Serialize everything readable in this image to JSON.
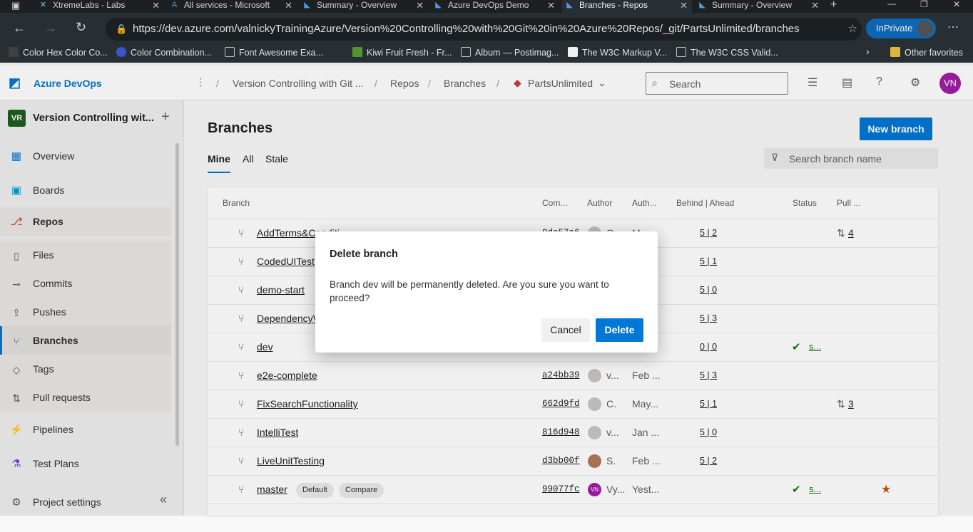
{
  "browser": {
    "tabs": [
      {
        "label": "XtremeLabs - Labs",
        "icon": "xtremelabs-icon"
      },
      {
        "label": "All services - Microsoft",
        "icon": "azure-icon"
      },
      {
        "label": "Summary - Overview",
        "icon": "azure-devops-icon"
      },
      {
        "label": "Azure DevOps Demo",
        "icon": "azure-devops-icon"
      },
      {
        "label": "Branches - Repos",
        "icon": "azure-devops-icon",
        "active": true
      },
      {
        "label": "Summary - Overview",
        "icon": "azure-devops-icon"
      }
    ],
    "url": "https://dev.azure.com/valnickyTrainingAzure/Version%20Controlling%20with%20Git%20in%20Azure%20Repos/_git/PartsUnlimited/branches",
    "inprivate_label": "InPrivate",
    "favorites": [
      "Color Hex Color Co...",
      "Color Combination...",
      "Font Awesome Exa...",
      "Kiwi Fruit Fresh - Fr...",
      "Album — Postimag...",
      "The W3C Markup V...",
      "The W3C CSS Valid..."
    ],
    "other_favorites": "Other favorites"
  },
  "header": {
    "brand": "Azure DevOps",
    "breadcrumb": [
      "Version Controlling with Git ...",
      "Repos",
      "Branches",
      "PartsUnlimited"
    ],
    "search_placeholder": "Search",
    "user_initials": "VN"
  },
  "project": {
    "badge": "VR",
    "name": "Version Controlling wit..."
  },
  "nav": {
    "items": [
      {
        "label": "Overview",
        "icon": "overview-icon"
      },
      {
        "label": "Boards",
        "icon": "boards-icon"
      },
      {
        "label": "Repos",
        "icon": "repos-icon"
      },
      {
        "label": "Files",
        "icon": "files-icon"
      },
      {
        "label": "Commits",
        "icon": "commits-icon"
      },
      {
        "label": "Pushes",
        "icon": "pushes-icon"
      },
      {
        "label": "Branches",
        "icon": "branches-icon"
      },
      {
        "label": "Tags",
        "icon": "tags-icon"
      },
      {
        "label": "Pull requests",
        "icon": "pull-requests-icon"
      },
      {
        "label": "Pipelines",
        "icon": "pipelines-icon"
      },
      {
        "label": "Test Plans",
        "icon": "test-plans-icon"
      }
    ],
    "settings": "Project settings"
  },
  "page": {
    "title": "Branches",
    "new_branch": "New branch",
    "tabs": [
      "Mine",
      "All",
      "Stale"
    ],
    "search_placeholder": "Search branch name"
  },
  "table": {
    "columns": [
      "Branch",
      "Com...",
      "Author",
      "Auth...",
      "Behind | Ahead",
      "Status",
      "Pull ..."
    ],
    "rows": [
      {
        "name": "AddTerms&Conditi",
        "commit": "9de57a6",
        "author": "C.",
        "date": "M...",
        "behind": "5",
        "ahead": "2",
        "prs": "4"
      },
      {
        "name": "CodedUITest",
        "commit": "",
        "author": "",
        "date": "",
        "behind": "5",
        "ahead": "1"
      },
      {
        "name": "demo-start",
        "commit": "",
        "author": "",
        "date": "",
        "behind": "5",
        "ahead": "0"
      },
      {
        "name": "DependencyV",
        "commit": "",
        "author": "",
        "date": "",
        "behind": "5",
        "ahead": "3"
      },
      {
        "name": "dev",
        "commit": "",
        "author": "",
        "date": "",
        "behind": "0",
        "ahead": "0",
        "status": "s..."
      },
      {
        "name": "e2e-complete",
        "commit": "a24bb39",
        "author": "v...",
        "date": "Feb ...",
        "behind": "5",
        "ahead": "3"
      },
      {
        "name": "FixSearchFunctionality",
        "commit": "662d9fd",
        "author": "C.",
        "date": "May...",
        "behind": "5",
        "ahead": "1",
        "prs": "3"
      },
      {
        "name": "IntelliTest",
        "commit": "816d948",
        "author": "v...",
        "date": "Jan ...",
        "behind": "5",
        "ahead": "0"
      },
      {
        "name": "LiveUnitTesting",
        "commit": "d3bb00f",
        "author": "S.",
        "date": "Feb ...",
        "behind": "5",
        "ahead": "2"
      },
      {
        "name": "master",
        "commit": "99077fc",
        "author": "Vy...",
        "date": "Yest...",
        "behind": "",
        "ahead": "",
        "status": "s...",
        "default_pill": "Default",
        "compare_pill": "Compare",
        "avatar_initials": "VN"
      }
    ]
  },
  "dialog": {
    "title": "Delete branch",
    "message": "Branch dev will be permanently deleted. Are you sure you want to proceed?",
    "cancel": "Cancel",
    "delete": "Delete"
  },
  "colors": {
    "accent": "#0078d4",
    "success": "#107c10",
    "avatar": "#a11ea1",
    "star": "#ca5010"
  }
}
